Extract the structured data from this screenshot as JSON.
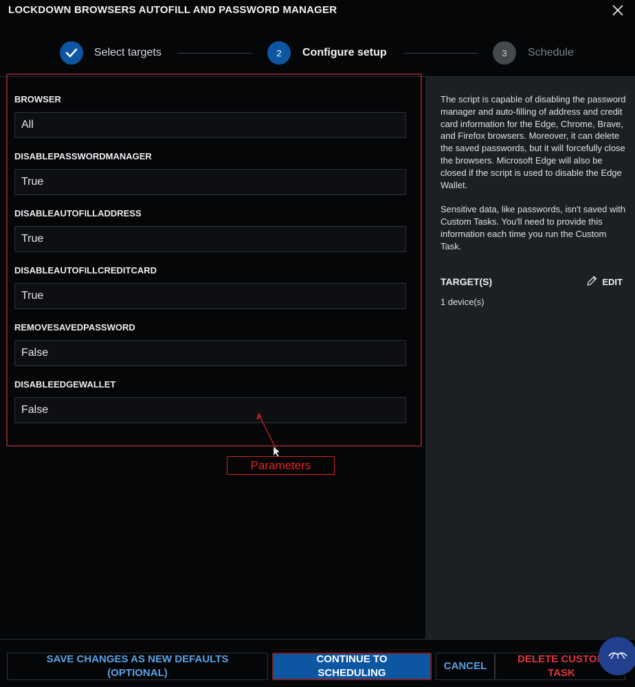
{
  "dialog": {
    "title": "LOCKDOWN BROWSERS AUTOFILL AND PASSWORD MANAGER"
  },
  "stepper": {
    "steps": [
      {
        "number": "",
        "label": "Select targets",
        "state": "complete"
      },
      {
        "number": "2",
        "label": "Configure setup",
        "state": "active"
      },
      {
        "number": "3",
        "label": "Schedule",
        "state": "inactive"
      }
    ]
  },
  "parameters": [
    {
      "label": "BROWSER",
      "value": "All"
    },
    {
      "label": "DISABLEPASSWORDMANAGER",
      "value": "True"
    },
    {
      "label": "DISABLEAUTOFILLADDRESS",
      "value": "True"
    },
    {
      "label": "DISABLEAUTOFILLCREDITCARD",
      "value": "True"
    },
    {
      "label": "REMOVESAVEDPASSWORD",
      "value": "False"
    },
    {
      "label": "DISABLEEDGEWALLET",
      "value": "False"
    }
  ],
  "annotation": {
    "label": "Parameters"
  },
  "info_panel": {
    "description_1": "The script is capable of disabling the password manager and auto-filling of address and credit card information for the Edge, Chrome, Brave, and Firefox browsers. Moreover, it can delete the saved passwords, but it will forcefully close the browsers. Microsoft Edge will also be closed if the script is used to disable the Edge Wallet.",
    "description_2": "Sensitive data, like passwords, isn't saved with Custom Tasks. You'll need to provide this information each time you run the Custom Task.",
    "targets_heading": "TARGET(S)",
    "edit_label": "EDIT",
    "device_count": "1 device(s)"
  },
  "footer": {
    "save_defaults_line1": "SAVE CHANGES AS NEW DEFAULTS",
    "save_defaults_line2": "(OPTIONAL)",
    "continue_line1": "CONTINUE TO",
    "continue_line2": "SCHEDULING",
    "cancel_label": "CANCEL",
    "delete_line1": "DELETE CUSTOM",
    "delete_line2": "TASK"
  },
  "colors": {
    "background": "#050608",
    "panel": "#1c1f23",
    "accent_blue": "#0c56a2",
    "link_blue": "#5aa2e6",
    "danger_red": "#e0333b",
    "annotation_red": "#d42020"
  }
}
